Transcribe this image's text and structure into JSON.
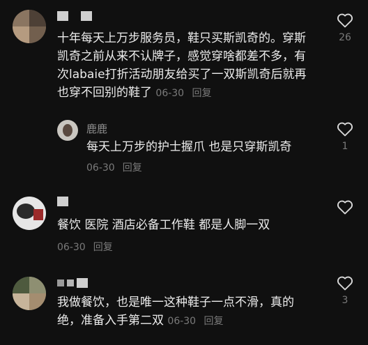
{
  "comments": [
    {
      "text": "十年每天上万步服务员，鞋只买斯凯奇的。穿斯凯奇之前从来不认牌子，感觉穿啥都差不多，有次labaie打折活动朋友给买了一双斯凯奇后就再也穿不回别的鞋了",
      "date": "06-30",
      "reply_label": "回复",
      "like_count": "26",
      "reply": {
        "username": "鹿鹿",
        "text": "每天上万步的护士握爪 也是只穿斯凯奇",
        "date": "06-30",
        "reply_label": "回复",
        "like_count": "1"
      }
    },
    {
      "text": "餐饮 医院 酒店必备工作鞋 都是人脚一双",
      "date": "06-30",
      "reply_label": "回复",
      "like_count": ""
    },
    {
      "text": "我做餐饮，也是唯一这种鞋子一点不滑，真的绝，准备入手第二双",
      "date": "06-30",
      "reply_label": "回复",
      "like_count": "3"
    }
  ],
  "icons": {
    "like": "heart-outline-icon"
  },
  "colors": {
    "background": "#101010",
    "text": "#ececec",
    "muted": "#7a7a7a"
  }
}
